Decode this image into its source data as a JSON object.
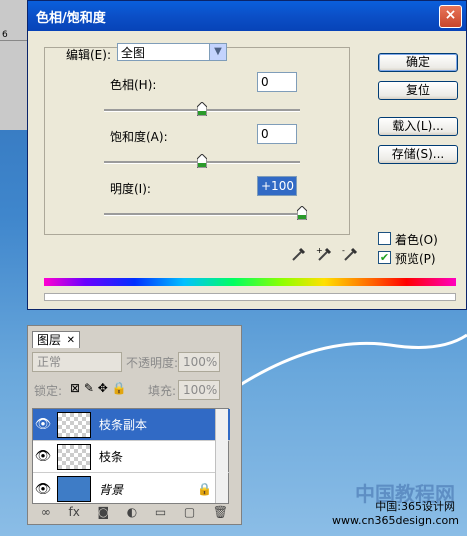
{
  "ruler": {
    "tick": "6"
  },
  "dialog": {
    "title": "色相/饱和度",
    "close": "×",
    "edit_label": "编辑(E):",
    "edit_value": "全图",
    "hue_label": "色相(H):",
    "hue_value": "0",
    "saturation_label": "饱和度(A):",
    "saturation_value": "0",
    "lightness_label": "明度(I):",
    "lightness_value": "+100",
    "buttons": {
      "ok": "确定",
      "reset": "复位",
      "load": "载入(L)...",
      "save": "存储(S)..."
    },
    "colorize_label": "着色(O)",
    "preview_label": "预览(P)",
    "levels": {
      "hue": 0,
      "saturation": 0,
      "lightness": 100
    }
  },
  "layers": {
    "tab": "图层",
    "blend_mode": "正常",
    "opacity_label": "不透明度:",
    "opacity_value": "100%",
    "lock_label": "锁定:",
    "fill_label": "填充:",
    "fill_value": "100%",
    "items": [
      {
        "name": "枝条副本"
      },
      {
        "name": "枝条"
      },
      {
        "name": "背景"
      }
    ],
    "footer": "fx"
  },
  "watermark": {
    "line1": "中国教程网",
    "line2": "中国:365设计网",
    "line3": "www.cn365design.com"
  }
}
